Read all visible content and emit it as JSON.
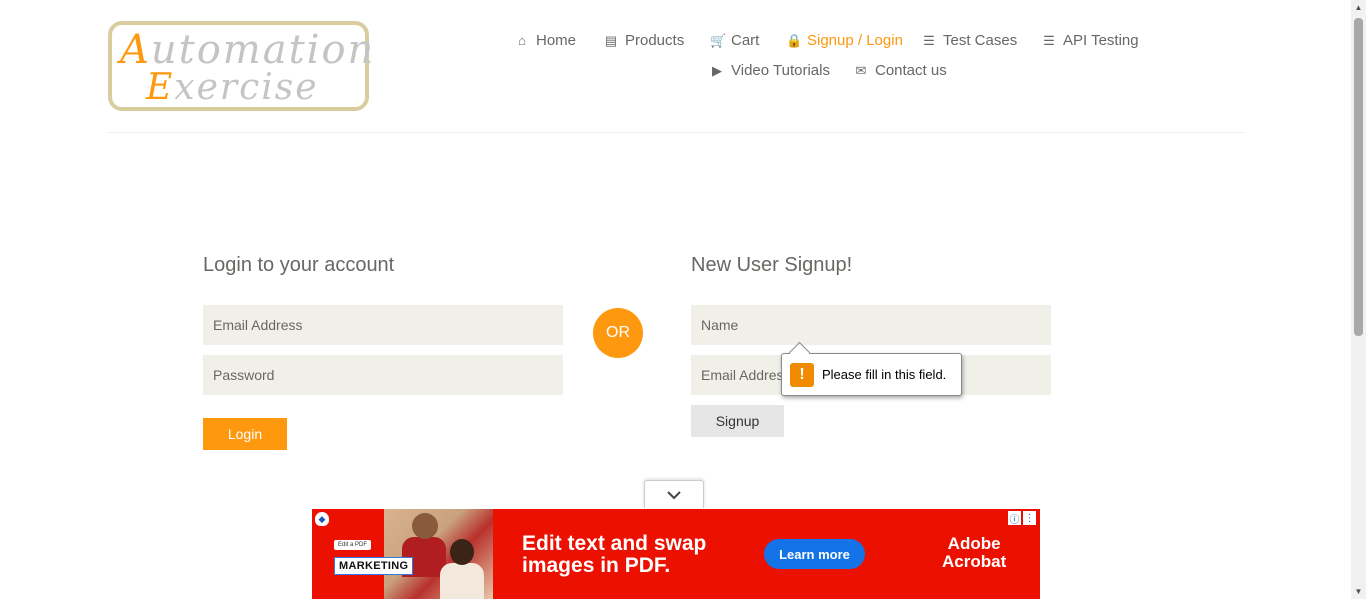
{
  "logo": {
    "line1_cap": "A",
    "line1_rest": "utomation",
    "line2_cap": "E",
    "line2_rest": "xercise"
  },
  "nav": {
    "items": [
      {
        "label": "Home",
        "icon": "home-icon"
      },
      {
        "label": "Products",
        "icon": "briefcase-icon"
      },
      {
        "label": "Cart",
        "icon": "cart-icon"
      },
      {
        "label": "Signup / Login",
        "icon": "lock-icon",
        "active": true
      },
      {
        "label": "Test Cases",
        "icon": "list-icon"
      },
      {
        "label": "API Testing",
        "icon": "list-icon"
      },
      {
        "label": "Video Tutorials",
        "icon": "youtube-icon"
      },
      {
        "label": "Contact us",
        "icon": "envelope-icon"
      }
    ],
    "active_color": "#fe980f"
  },
  "login": {
    "title": "Login to your account",
    "email_placeholder": "Email Address",
    "password_placeholder": "Password",
    "button": "Login"
  },
  "or_label": "OR",
  "signup": {
    "title": "New User Signup!",
    "name_placeholder": "Name",
    "email_placeholder": "Email Address",
    "button": "Signup"
  },
  "tooltip": {
    "icon": "!",
    "message": "Please fill in this field."
  },
  "ad": {
    "chip": "Edit a PDF",
    "tag": "MARKETING",
    "headline": "Edit text and swap images in PDF.",
    "cta": "Learn more",
    "brand_line1": "Adobe",
    "brand_line2": "Acrobat",
    "bg_color": "#eb1000"
  }
}
